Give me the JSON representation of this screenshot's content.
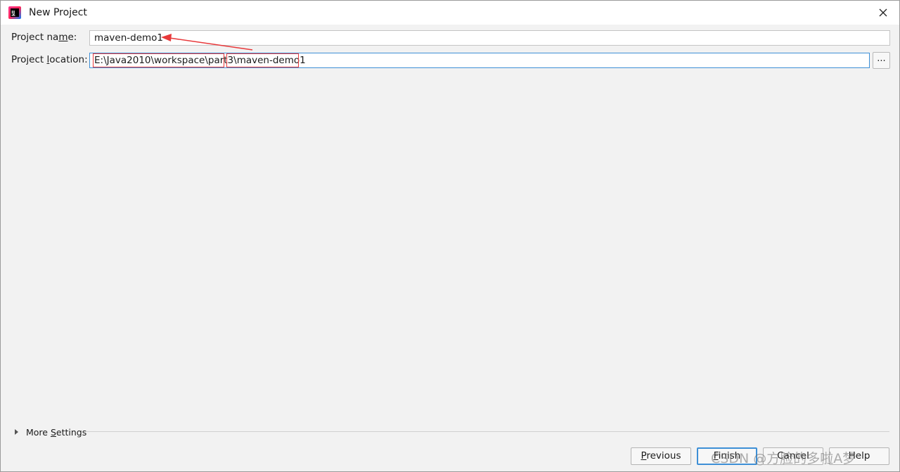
{
  "window": {
    "title": "New Project"
  },
  "form": {
    "project_name_label_pre": "Project na",
    "project_name_label_mnemonic": "m",
    "project_name_label_post": "e:",
    "project_name_value": "maven-demo1",
    "project_location_label_pre": "Project ",
    "project_location_label_mnemonic": "l",
    "project_location_label_post": "ocation:",
    "project_location_value": "E:\\Java2010\\workspace\\part3\\maven-demo1",
    "browse_label": "..."
  },
  "more_settings": {
    "label_pre": "More ",
    "label_mnemonic": "S",
    "label_post": "ettings"
  },
  "buttons": {
    "previous_mnemonic": "P",
    "previous_rest": "revious",
    "finish_mnemonic": "F",
    "finish_rest": "inish",
    "cancel": "Cancel",
    "help": "Help"
  },
  "watermark": "CSDN @方脸的多啦A梦",
  "colors": {
    "annotation": "#e8393b",
    "focus_border": "#3d8fd6",
    "dialog_bg": "#f2f2f2"
  },
  "icons": {
    "app": "intellij-idea-icon",
    "close": "close-icon",
    "expand": "triangle-right-icon"
  }
}
